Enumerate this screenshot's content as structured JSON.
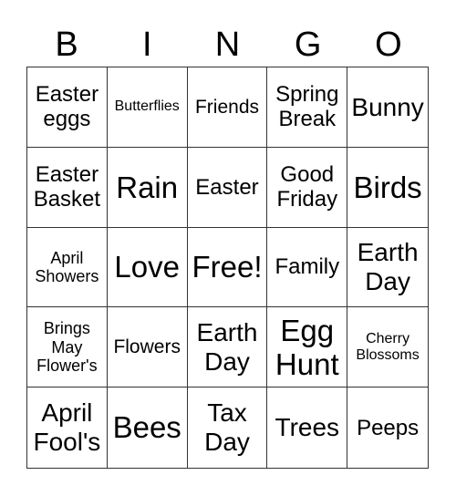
{
  "header": [
    "B",
    "I",
    "N",
    "G",
    "O"
  ],
  "cells": [
    "Easter eggs",
    "Butterflies",
    "Friends",
    "Spring Break",
    "Bunny",
    "Easter Basket",
    "Rain",
    "Easter",
    "Good Friday",
    "Birds",
    "April Showers",
    "Love",
    "Free!",
    "Family",
    "Earth Day",
    "Brings May Flower's",
    "Flowers",
    "Earth Day",
    "Egg Hunt",
    "Cherry Blossoms",
    "April Fool's",
    "Bees",
    "Tax Day",
    "Trees",
    "Peeps"
  ]
}
